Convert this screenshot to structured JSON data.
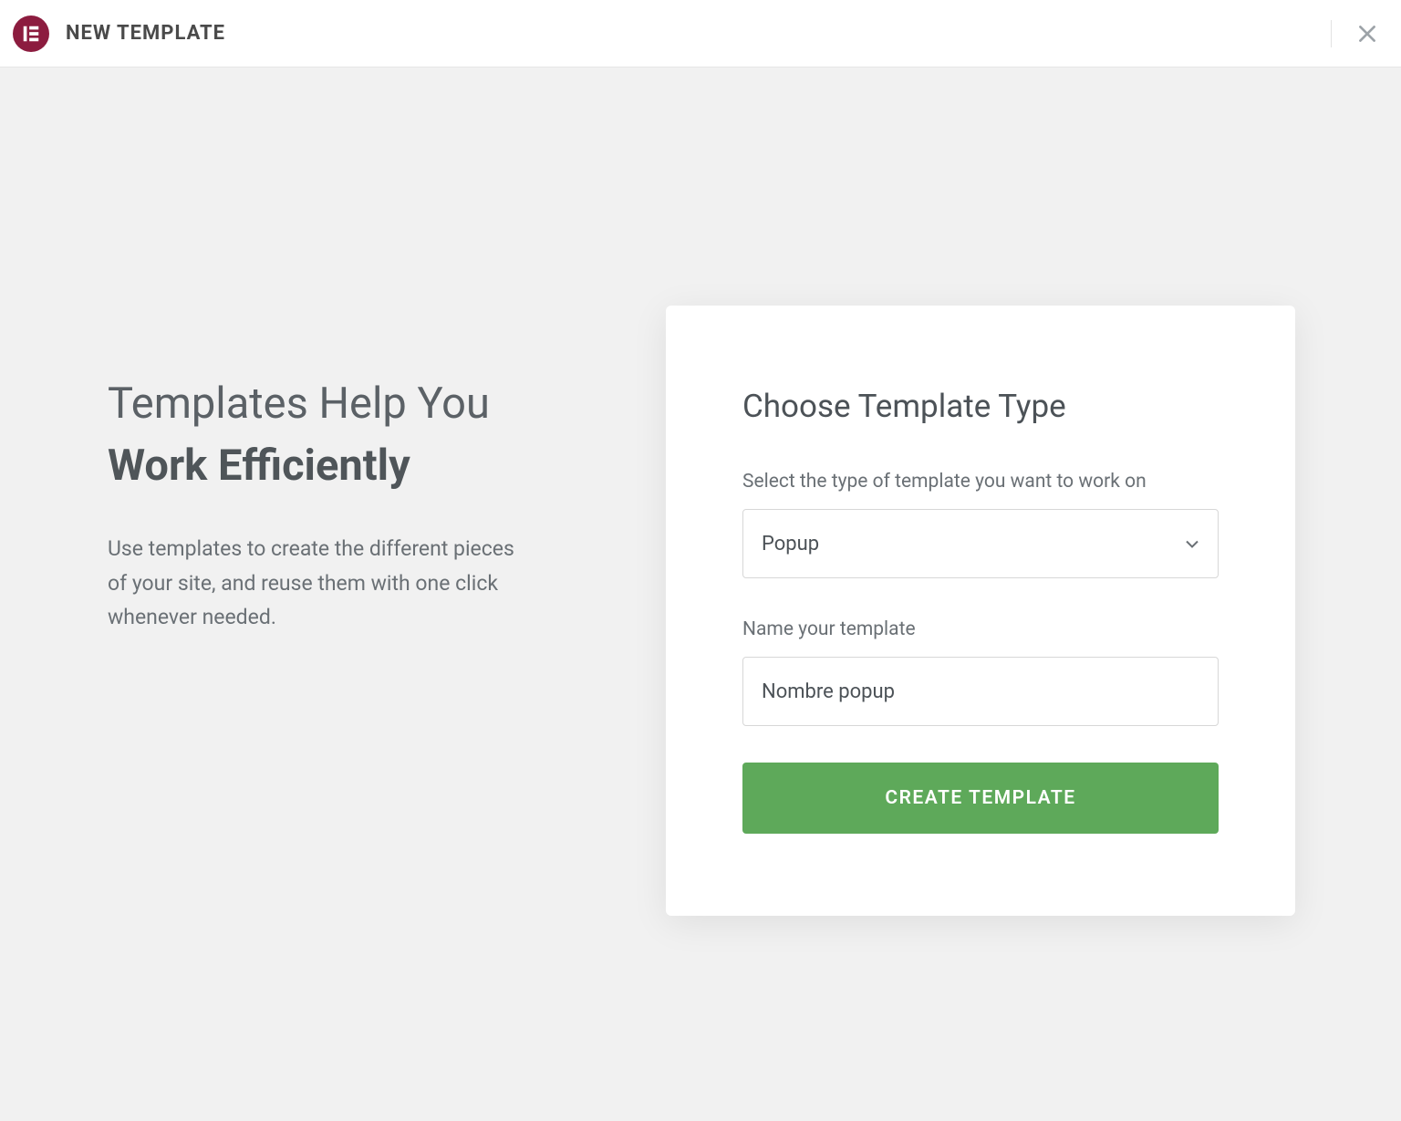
{
  "header": {
    "title": "NEW TEMPLATE"
  },
  "left": {
    "heading_line1": "Templates Help You",
    "heading_line2": "Work Efficiently",
    "description": "Use templates to create the different pieces of your site, and reuse them with one click whenever needed."
  },
  "card": {
    "title": "Choose Template Type",
    "type_label": "Select the type of template you want to work on",
    "type_value": "Popup",
    "name_label": "Name your template",
    "name_value": "Nombre popup",
    "create_label": "CREATE TEMPLATE"
  }
}
